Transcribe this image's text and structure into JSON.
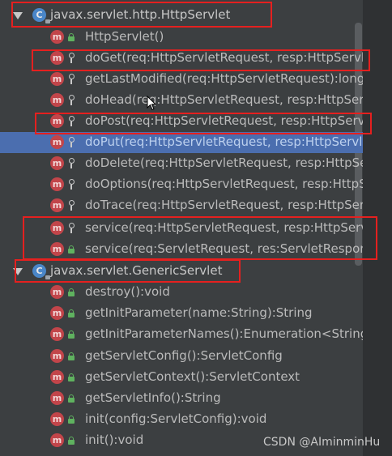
{
  "tree": {
    "classes": [
      {
        "name": "javax.servlet.http.HttpServlet",
        "class_icon": "C",
        "methods": [
          {
            "label": "HttpServlet()",
            "visibility": "public"
          },
          {
            "label": "doGet(req:HttpServletRequest, resp:HttpServle",
            "visibility": "protected"
          },
          {
            "label": "getLastModified(req:HttpServletRequest):long",
            "visibility": "protected"
          },
          {
            "label": "doHead(req:HttpServletRequest, resp:HttpServletRe",
            "visibility": "protected"
          },
          {
            "label": "doPost(req:HttpServletRequest, resp:HttpServ",
            "visibility": "protected"
          },
          {
            "label": "doPut(req:HttpServletRequest, resp:HttpServle",
            "visibility": "protected"
          },
          {
            "label": "doDelete(req:HttpServletRequest, resp:HttpSe",
            "visibility": "protected"
          },
          {
            "label": "doOptions(req:HttpServletRequest, resp:HttpS",
            "visibility": "protected"
          },
          {
            "label": "doTrace(req:HttpServletRequest, resp:HttpSer",
            "visibility": "protected"
          },
          {
            "label": "service(req:HttpServletRequest, resp:HttpServl",
            "visibility": "protected"
          },
          {
            "label": "service(req:ServletRequest, res:ServletRespons",
            "visibility": "public"
          }
        ]
      },
      {
        "name": "javax.servlet.GenericServlet",
        "class_icon": "C",
        "methods": [
          {
            "label": "destroy():void",
            "visibility": "public"
          },
          {
            "label": "getInitParameter(name:String):String",
            "visibility": "public"
          },
          {
            "label": "getInitParameterNames():Enumeration<String>",
            "visibility": "public"
          },
          {
            "label": "getServletConfig():ServletConfig",
            "visibility": "public"
          },
          {
            "label": "getServletContext():ServletContext",
            "visibility": "public"
          },
          {
            "label": "getServletInfo():String",
            "visibility": "public"
          },
          {
            "label": "init(config:ServletConfig):void",
            "visibility": "public"
          },
          {
            "label": "init():void",
            "visibility": "public"
          }
        ]
      }
    ],
    "selected_method": "doPut(req:HttpServletRequest, resp:HttpServle",
    "method_icon": "m"
  },
  "watermark": "CSDN @AIminminHu",
  "colors": {
    "background": "#3c3f41",
    "selection": "#4b6eaf",
    "method_icon": "#c2454a",
    "class_icon": "#4a86c8",
    "highlight_box": "#e5201f",
    "public_lock": "#5fb25f"
  }
}
